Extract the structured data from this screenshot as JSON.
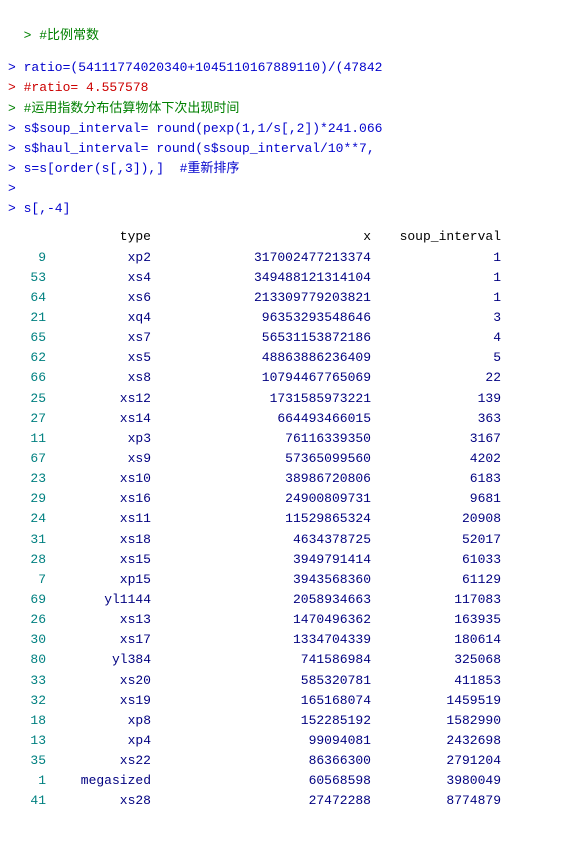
{
  "console": {
    "lines": [
      {
        "type": "comment",
        "text": "> #比例常数"
      },
      {
        "type": "code",
        "text": "> ratio=(54111774020340+1045110167889110)/(47842"
      },
      {
        "type": "output",
        "text": "> #ratio= 4.557578"
      },
      {
        "type": "comment",
        "text": "> #运用指数分布估算物体下次出现时间"
      },
      {
        "type": "code",
        "text": "> s$soup_interval= round(pexp(1,1/s[,2])*241.066"
      },
      {
        "type": "code",
        "text": "> s$haul_interval= round(s$soup_interval/10**7,"
      },
      {
        "type": "code",
        "text": "> s=s[order(s[,3]),]  #重新排序"
      },
      {
        "type": "blank",
        "text": ">"
      },
      {
        "type": "code",
        "text": "> s[,-4]"
      }
    ]
  },
  "table": {
    "headers": {
      "index": "",
      "type": "type",
      "x": "x",
      "soup_interval": "soup_interval"
    },
    "rows": [
      {
        "index": "9",
        "type": "xp2",
        "x": "317002477213374",
        "si": "1"
      },
      {
        "index": "53",
        "type": "xs4",
        "x": "349488121314104",
        "si": "1"
      },
      {
        "index": "64",
        "type": "xs6",
        "x": "213309779203821",
        "si": "1"
      },
      {
        "index": "21",
        "type": "xq4",
        "x": "96353293548646",
        "si": "3"
      },
      {
        "index": "65",
        "type": "xs7",
        "x": "56531153872186",
        "si": "4"
      },
      {
        "index": "62",
        "type": "xs5",
        "x": "48863886236409",
        "si": "5"
      },
      {
        "index": "66",
        "type": "xs8",
        "x": "10794467765069",
        "si": "22"
      },
      {
        "index": "25",
        "type": "xs12",
        "x": "1731585973221",
        "si": "139"
      },
      {
        "index": "27",
        "type": "xs14",
        "x": "664493466015",
        "si": "363"
      },
      {
        "index": "11",
        "type": "xp3",
        "x": "76116339350",
        "si": "3167"
      },
      {
        "index": "67",
        "type": "xs9",
        "x": "57365099560",
        "si": "4202"
      },
      {
        "index": "23",
        "type": "xs10",
        "x": "38986720806",
        "si": "6183"
      },
      {
        "index": "29",
        "type": "xs16",
        "x": "24900809731",
        "si": "9681"
      },
      {
        "index": "24",
        "type": "xs11",
        "x": "11529865324",
        "si": "20908"
      },
      {
        "index": "31",
        "type": "xs18",
        "x": "4634378725",
        "si": "52017"
      },
      {
        "index": "28",
        "type": "xs15",
        "x": "3949791414",
        "si": "61033"
      },
      {
        "index": "7",
        "type": "xp15",
        "x": "3943568360",
        "si": "61129"
      },
      {
        "index": "69",
        "type": "yl1144",
        "x": "2058934663",
        "si": "117083"
      },
      {
        "index": "26",
        "type": "xs13",
        "x": "1470496362",
        "si": "163935"
      },
      {
        "index": "30",
        "type": "xs17",
        "x": "1334704339",
        "si": "180614"
      },
      {
        "index": "80",
        "type": "yl384",
        "x": "741586984",
        "si": "325068"
      },
      {
        "index": "33",
        "type": "xs20",
        "x": "585320781",
        "si": "411853"
      },
      {
        "index": "32",
        "type": "xs19",
        "x": "165168074",
        "si": "1459519"
      },
      {
        "index": "18",
        "type": "xp8",
        "x": "152285192",
        "si": "1582990"
      },
      {
        "index": "13",
        "type": "xp4",
        "x": "99094081",
        "si": "2432698"
      },
      {
        "index": "35",
        "type": "xs22",
        "x": "86366300",
        "si": "2791204"
      },
      {
        "index": "1",
        "type": "megasized",
        "x": "60568598",
        "si": "3980049"
      },
      {
        "index": "41",
        "type": "xs28",
        "x": "27472288",
        "si": "8774879"
      }
    ]
  }
}
